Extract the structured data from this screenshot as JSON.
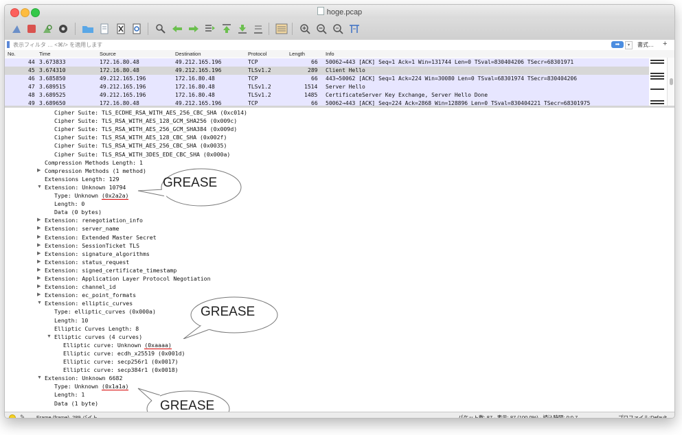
{
  "window": {
    "title": "hoge.pcap"
  },
  "filter": {
    "placeholder": "表示フィルタ … <⌘/> を適用します",
    "apply_icon": "right-arrow-icon",
    "format_label": "書式…",
    "add_label": "+"
  },
  "packet_list": {
    "columns": [
      "No.",
      "Time",
      "Source",
      "Destination",
      "Protocol",
      "Length",
      "Info"
    ],
    "rows": [
      {
        "no": "44",
        "time": "3.673833",
        "src": "172.16.80.48",
        "dst": "49.212.165.196",
        "proto": "TCP",
        "len": "66",
        "info": "50062→443 [ACK] Seq=1 Ack=1 Win=131744 Len=0 TSval=830404206 TSecr=68301971",
        "style": "tcp"
      },
      {
        "no": "45",
        "time": "3.674310",
        "src": "172.16.80.48",
        "dst": "49.212.165.196",
        "proto": "TLSv1.2",
        "len": "289",
        "info": "Client Hello",
        "style": "selected"
      },
      {
        "no": "46",
        "time": "3.685850",
        "src": "49.212.165.196",
        "dst": "172.16.80.48",
        "proto": "TCP",
        "len": "66",
        "info": "443→50062 [ACK] Seq=1 Ack=224 Win=30080 Len=0 TSval=68301974 TSecr=830404206",
        "style": "tcp"
      },
      {
        "no": "47",
        "time": "3.689515",
        "src": "49.212.165.196",
        "dst": "172.16.80.48",
        "proto": "TLSv1.2",
        "len": "1514",
        "info": "Server Hello",
        "style": "tcp"
      },
      {
        "no": "48",
        "time": "3.689525",
        "src": "49.212.165.196",
        "dst": "172.16.80.48",
        "proto": "TLSv1.2",
        "len": "1485",
        "info": "CertificateServer Key Exchange, Server Hello Done",
        "style": "tcp"
      },
      {
        "no": "49",
        "time": "3.689650",
        "src": "172.16.80.48",
        "dst": "49.212.165.196",
        "proto": "TCP",
        "len": "66",
        "info": "50062→443 [ACK] Seq=224 Ack=2868 Win=128896 Len=0 TSval=830404221 TSecr=68301975",
        "style": "tcp"
      }
    ]
  },
  "details": [
    {
      "indent": 2,
      "text": "Cipher Suite: TLS_ECDHE_RSA_WITH_AES_256_CBC_SHA (0xc014)"
    },
    {
      "indent": 2,
      "text": "Cipher Suite: TLS_RSA_WITH_AES_128_GCM_SHA256 (0x009c)"
    },
    {
      "indent": 2,
      "text": "Cipher Suite: TLS_RSA_WITH_AES_256_GCM_SHA384 (0x009d)"
    },
    {
      "indent": 2,
      "text": "Cipher Suite: TLS_RSA_WITH_AES_128_CBC_SHA (0x002f)"
    },
    {
      "indent": 2,
      "text": "Cipher Suite: TLS_RSA_WITH_AES_256_CBC_SHA (0x0035)"
    },
    {
      "indent": 2,
      "text": "Cipher Suite: TLS_RSA_WITH_3DES_EDE_CBC_SHA (0x000a)"
    },
    {
      "indent": 1,
      "text": "Compression Methods Length: 1"
    },
    {
      "indent": 1,
      "tri": "collapsed",
      "text": "Compression Methods (1 method)"
    },
    {
      "indent": 1,
      "text": "Extensions Length: 129"
    },
    {
      "indent": 1,
      "tri": "expanded",
      "text": "Extension: Unknown 10794"
    },
    {
      "indent": 2,
      "text": "Type: Unknown ",
      "hl": "(0x2a2a)"
    },
    {
      "indent": 2,
      "text": "Length: 0"
    },
    {
      "indent": 2,
      "text": "Data (0 bytes)"
    },
    {
      "indent": 1,
      "tri": "collapsed",
      "text": "Extension: renegotiation_info"
    },
    {
      "indent": 1,
      "tri": "collapsed",
      "text": "Extension: server_name"
    },
    {
      "indent": 1,
      "tri": "collapsed",
      "text": "Extension: Extended Master Secret"
    },
    {
      "indent": 1,
      "tri": "collapsed",
      "text": "Extension: SessionTicket TLS"
    },
    {
      "indent": 1,
      "tri": "collapsed",
      "text": "Extension: signature_algorithms"
    },
    {
      "indent": 1,
      "tri": "collapsed",
      "text": "Extension: status_request"
    },
    {
      "indent": 1,
      "tri": "collapsed",
      "text": "Extension: signed_certificate_timestamp"
    },
    {
      "indent": 1,
      "tri": "collapsed",
      "text": "Extension: Application Layer Protocol Negotiation"
    },
    {
      "indent": 1,
      "tri": "collapsed",
      "text": "Extension: channel_id"
    },
    {
      "indent": 1,
      "tri": "collapsed",
      "text": "Extension: ec_point_formats"
    },
    {
      "indent": 1,
      "tri": "expanded",
      "text": "Extension: elliptic_curves"
    },
    {
      "indent": 2,
      "text": "Type: elliptic_curves (0x000a)"
    },
    {
      "indent": 2,
      "text": "Length: 10"
    },
    {
      "indent": 2,
      "text": "Elliptic Curves Length: 8"
    },
    {
      "indent": 2,
      "tri": "expanded",
      "text": "Elliptic curves (4 curves)"
    },
    {
      "indent": 3,
      "text": "Elliptic curve: Unknown ",
      "hl": "(0xaaaa)"
    },
    {
      "indent": 3,
      "text": "Elliptic curve: ecdh_x25519 (0x001d)"
    },
    {
      "indent": 3,
      "text": "Elliptic curve: secp256r1 (0x0017)"
    },
    {
      "indent": 3,
      "text": "Elliptic curve: secp384r1 (0x0018)"
    },
    {
      "indent": 1,
      "tri": "expanded",
      "text": "Extension: Unknown 6682"
    },
    {
      "indent": 2,
      "text": "Type: Unknown ",
      "hl": "(0x1a1a)"
    },
    {
      "indent": 2,
      "text": "Length: 1"
    },
    {
      "indent": 2,
      "text": "Data (1 byte)"
    }
  ],
  "annotations": [
    "GREASE",
    "GREASE",
    "GREASE"
  ],
  "status": {
    "frame": "Frame (frame), 289 バイト",
    "packets": "パケット数: 87 · 表示: 87 (100.0%) · 読込時間: 0:0.7",
    "profile": "プロファイル:Default"
  },
  "colors": {
    "tcp_row": "#e7e6ff",
    "selected_row": "#d7d7d7",
    "annotation_underline": "#d60000",
    "apply_button": "#4b8de0"
  }
}
